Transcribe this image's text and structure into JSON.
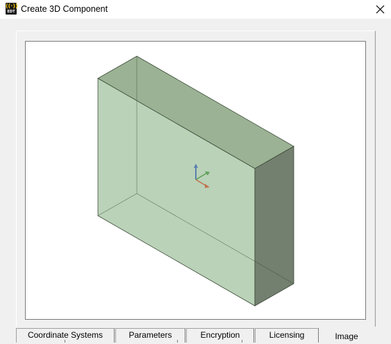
{
  "window": {
    "title": "Create 3D Component",
    "app_icon": {
      "name": "ansys-edt-icon",
      "text": "EDT"
    },
    "close_icon": "close-icon"
  },
  "preview": {
    "description_icon": "3d-box-preview",
    "colors": {
      "front": "#b6d0b4",
      "top": "#9bb294",
      "side": "#737f6f",
      "edge": "#3b4a38",
      "axis_z": "#5a7fb0",
      "axis_y": "#5fa05a",
      "axis_x": "#c2724f"
    }
  },
  "tabs": [
    {
      "label": "Coordinate Systems",
      "active": false
    },
    {
      "label": "Parameters",
      "active": false
    },
    {
      "label": "Encryption",
      "active": false
    },
    {
      "label": "Licensing",
      "active": false
    },
    {
      "label": "Image",
      "active": true
    }
  ]
}
